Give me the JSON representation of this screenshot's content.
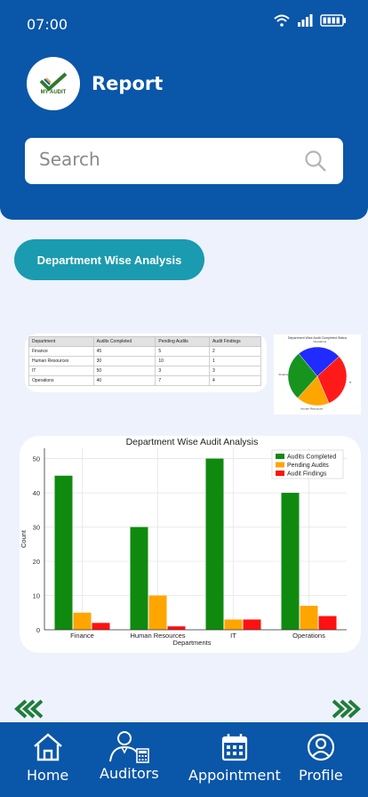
{
  "status": {
    "time": "07:00"
  },
  "app": {
    "title": "Report",
    "logo_text": "MY AUDIT"
  },
  "search": {
    "placeholder": "Search"
  },
  "section_button": "Department Wise Analysis",
  "summary_table": {
    "headers": [
      "Department",
      "Audits Completed",
      "Pending Audits",
      "Audit Findings"
    ],
    "rows": [
      [
        "Finance",
        "45",
        "5",
        "2"
      ],
      [
        "Human Resources",
        "30",
        "10",
        "1"
      ],
      [
        "IT",
        "50",
        "3",
        "3"
      ],
      [
        "Operations",
        "40",
        "7",
        "4"
      ]
    ]
  },
  "pie_thumb": {
    "title": "Department Wise Audit Completed Status",
    "labels": [
      "Operations",
      "IT",
      "Human Resources",
      "Finance"
    ],
    "values": [
      40,
      50,
      30,
      45
    ],
    "colors": [
      "#1f2bff",
      "#ff1a1a",
      "#ffa500",
      "#16941e"
    ]
  },
  "chart_data": {
    "type": "bar",
    "title": "Department Wise Audit Analysis",
    "xlabel": "Departments",
    "ylabel": "Count",
    "categories": [
      "Finance",
      "Human Resources",
      "IT",
      "Operations"
    ],
    "series": [
      {
        "name": "Audits Completed",
        "values": [
          45,
          30,
          50,
          40
        ],
        "color": "#0f8a0f"
      },
      {
        "name": "Pending Audits",
        "values": [
          5,
          10,
          3,
          7
        ],
        "color": "#ffa500"
      },
      {
        "name": "Audit Findings",
        "values": [
          2,
          1,
          3,
          4
        ],
        "color": "#ff1111"
      }
    ],
    "ylim": [
      0,
      53
    ],
    "yticks": [
      0,
      10,
      20,
      30,
      40,
      50
    ],
    "grid": true,
    "legend": "top-right"
  },
  "tabs": [
    {
      "label": "Home",
      "icon": "home-icon"
    },
    {
      "label": "Auditors",
      "icon": "auditor-icon"
    },
    {
      "label": "Appointment",
      "icon": "calendar-icon"
    },
    {
      "label": "Profile",
      "icon": "user-icon"
    }
  ],
  "colors": {
    "primary": "#0a56a8",
    "accent": "#1a9bb0",
    "nav_arrows": "#1e7d3a"
  }
}
